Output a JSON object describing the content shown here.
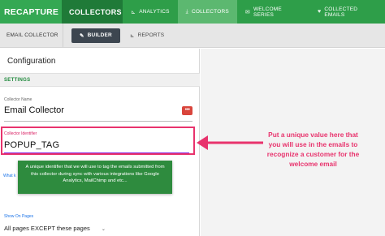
{
  "topnav": {
    "brand": "RECAPTURE",
    "section": "COLLECTORS",
    "tabs": [
      {
        "label": "ANALYTICS",
        "icon": "bar-chart-icon"
      },
      {
        "label": "COLLECTORS",
        "icon": "download-icon"
      },
      {
        "label": "WELCOME SERIES",
        "icon": "envelope-icon"
      },
      {
        "label": "COLLECTED EMAILS",
        "icon": "heart-icon"
      }
    ]
  },
  "subnav": {
    "title": "EMAIL COLLECTOR",
    "builder": "BUILDER",
    "reports": "REPORTS"
  },
  "panel": {
    "title": "Configuration",
    "settings": "SETTINGS",
    "name_label": "Collector Name",
    "name_value": "Email Collector",
    "id_label": "Collector Identifier",
    "id_value": "POPUP_TAG",
    "what_label": "What k",
    "tooltip": "A unique identifier that we will use to tag the emails submitted from this collector during sync with various integrations like Google Analytics, MailChimp and etc...",
    "show_label": "Show On Pages",
    "pages_value": "All pages EXCEPT these pages"
  },
  "annotation": "Put a unique value here that you will use in the emails to recognize a customer for the welcome email",
  "colors": {
    "brand_green": "#2e9e49",
    "accent_pink": "#e8336d",
    "tooltip_green": "#2e8b3e"
  }
}
